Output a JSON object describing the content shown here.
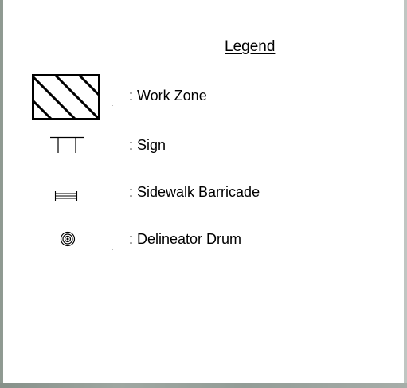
{
  "legend": {
    "title": "Legend",
    "items": [
      {
        "id": "work-zone",
        "label": ": Work Zone",
        "icon": "hatched-rectangle-icon"
      },
      {
        "id": "sign",
        "label": ": Sign",
        "icon": "sign-icon"
      },
      {
        "id": "sidewalk-barricade",
        "label": ": Sidewalk Barricade",
        "icon": "barricade-icon"
      },
      {
        "id": "delineator-drum",
        "label": ": Delineator Drum",
        "icon": "drum-icon"
      }
    ]
  },
  "colors": {
    "panel": "#ffffff",
    "ink": "#000000",
    "background": "#a2aca6"
  }
}
